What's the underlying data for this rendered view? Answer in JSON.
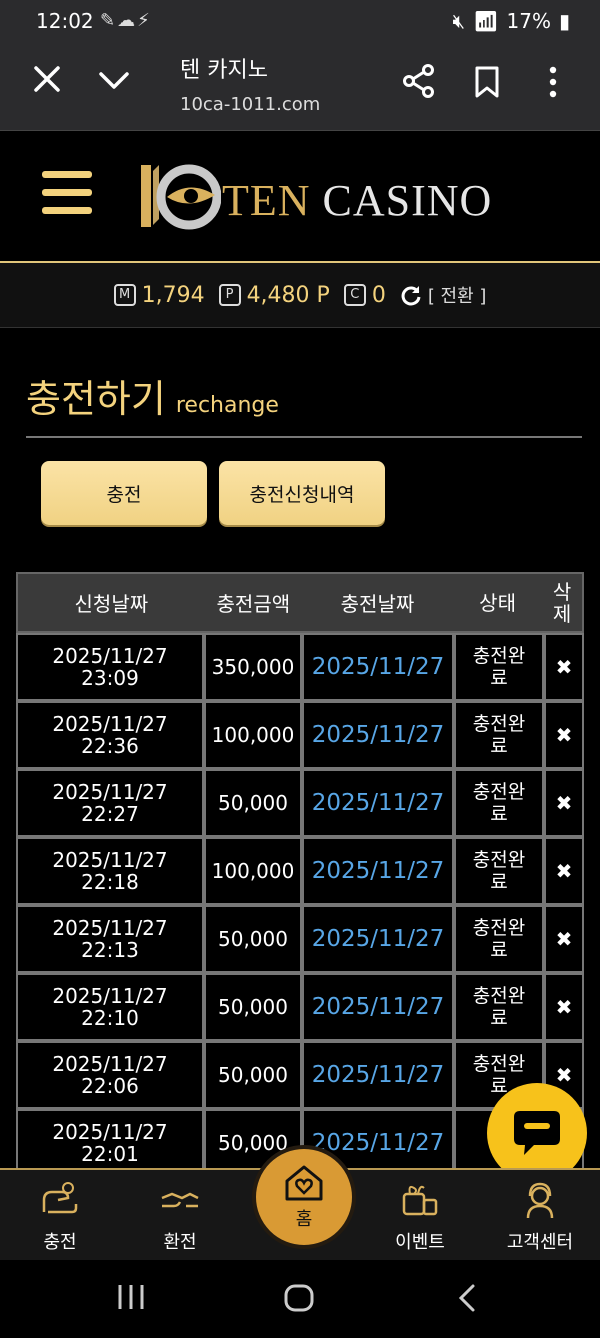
{
  "status": {
    "time": "12:02",
    "battery": "17%"
  },
  "browser": {
    "title": "텐 카지노",
    "url": "10ca-1011.com"
  },
  "site": {
    "logo_ten": "TEN",
    "logo_casino": "CASINO"
  },
  "wallet": {
    "money_label": "M",
    "money": "1,794",
    "point_label": "P",
    "point": "4,480 P",
    "coin_label": "C",
    "coin": "0",
    "convert": "[ 전환 ]"
  },
  "page": {
    "title_ko": "충전하기",
    "title_en": "rechange"
  },
  "buttons": {
    "charge": "충전",
    "history": "충전신청내역"
  },
  "table": {
    "headers": [
      "신청날짜",
      "충전금액",
      "충전날짜",
      "상태",
      "삭\n제"
    ],
    "rows": [
      {
        "req": "2025/11/27\n23:09",
        "amount": "350,000",
        "date": "2025/11/27",
        "status": "충전완\n료",
        "del": "✖"
      },
      {
        "req": "2025/11/27\n22:36",
        "amount": "100,000",
        "date": "2025/11/27",
        "status": "충전완\n료",
        "del": "✖"
      },
      {
        "req": "2025/11/27\n22:27",
        "amount": "50,000",
        "date": "2025/11/27",
        "status": "충전완\n료",
        "del": "✖"
      },
      {
        "req": "2025/11/27\n22:18",
        "amount": "100,000",
        "date": "2025/11/27",
        "status": "충전완\n료",
        "del": "✖"
      },
      {
        "req": "2025/11/27\n22:13",
        "amount": "50,000",
        "date": "2025/11/27",
        "status": "충전완\n료",
        "del": "✖"
      },
      {
        "req": "2025/11/27\n22:10",
        "amount": "50,000",
        "date": "2025/11/27",
        "status": "충전완\n료",
        "del": "✖"
      },
      {
        "req": "2025/11/27\n22:06",
        "amount": "50,000",
        "date": "2025/11/27",
        "status": "충전완\n료",
        "del": "✖"
      },
      {
        "req": "2025/11/27\n22:01",
        "amount": "50,000",
        "date": "2025/11/27",
        "status": "충",
        "del": ""
      }
    ]
  },
  "nav": {
    "charge": "충전",
    "exchange": "환전",
    "home": "홈",
    "event": "이벤트",
    "support": "고객센터"
  }
}
